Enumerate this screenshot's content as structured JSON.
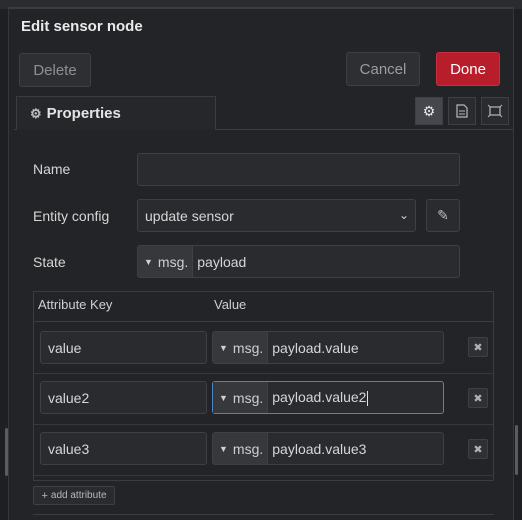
{
  "dialog": {
    "title": "Edit sensor node"
  },
  "toolbar": {
    "delete_label": "Delete",
    "cancel_label": "Cancel",
    "done_label": "Done"
  },
  "tabs": {
    "properties_label": "Properties",
    "icons": [
      "gear-icon",
      "document-icon",
      "frame-icon"
    ]
  },
  "form": {
    "name": {
      "label": "Name",
      "value": ""
    },
    "entity_config": {
      "label": "Entity config",
      "value": "update sensor"
    },
    "state": {
      "label": "State",
      "type_prefix": "msg.",
      "value": "payload"
    }
  },
  "attributes": {
    "header_key": "Attribute Key",
    "header_value": "Value",
    "rows": [
      {
        "key": "value",
        "type_prefix": "msg.",
        "value": "payload.value"
      },
      {
        "key": "value2",
        "type_prefix": "msg.",
        "value": "payload.value2"
      },
      {
        "key": "value3",
        "type_prefix": "msg.",
        "value": "payload.value3"
      }
    ],
    "add_label": "add attribute"
  },
  "colors": {
    "done": "#b81d2b",
    "focus": "#4a84c4",
    "background": "#232427"
  }
}
